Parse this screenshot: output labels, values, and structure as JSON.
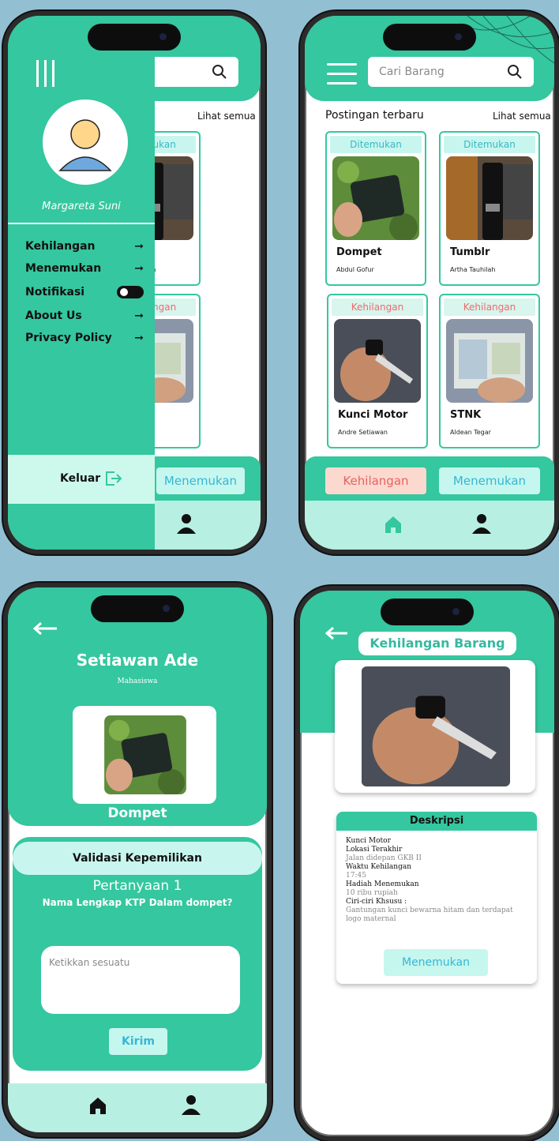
{
  "colors": {
    "background": "#93bfd3",
    "primary_green": "#35c79f",
    "mint": "#b7f0e2",
    "found_text": "#35b9c5",
    "lost_text": "#ef6b6b",
    "lost_button_bg": "#fbd9cf",
    "found_button_bg": "#c6f7ee"
  },
  "search": {
    "placeholder": "Cari Barang",
    "icon": "search-icon"
  },
  "feed": {
    "section_title": "Postingan terbaru",
    "see_all": "Lihat semua",
    "cards": [
      {
        "tag": "Ditemukan",
        "item": "Dompet",
        "person": "Abdul Gofur",
        "photo": "wallet"
      },
      {
        "tag": "Ditemukan",
        "item": "Tumblr",
        "person": "Artha Tauhilah",
        "photo": "tumbler"
      },
      {
        "tag": "Kehilangan",
        "item": "Kunci Motor",
        "person": "Andre Setiawan",
        "photo": "keys"
      },
      {
        "tag": "Kehilangan",
        "item": "STNK",
        "person": "Aldean Tegar",
        "photo": "stnk"
      }
    ],
    "btn_lost": "Kehilangan",
    "btn_found": "Menemukan"
  },
  "drawer": {
    "username": "Margareta Suni",
    "menu": [
      {
        "label": "Kehilangan",
        "trailing": "arrow"
      },
      {
        "label": "Menemukan",
        "trailing": "arrow"
      },
      {
        "label": "Notifikasi",
        "trailing": "toggle"
      },
      {
        "label": "About Us",
        "trailing": "arrow"
      },
      {
        "label": "Privacy Policy",
        "trailing": "arrow"
      }
    ],
    "logout": "Keluar"
  },
  "validation": {
    "owner_name": "Setiawan Ade",
    "owner_role": "Mahasiswa",
    "item": "Dompet",
    "section": "Validasi Kepemilikan",
    "question_number": "Pertanyaan 1",
    "question": "Nama Lengkap KTP Dalam dompet?",
    "answer_placeholder": "Ketikkan sesuatu",
    "submit": "Kirim"
  },
  "detail": {
    "title": "Kehilangan Barang",
    "desc_header": "Deskripsi",
    "item_name": "Kunci Motor",
    "location_label": "Lokasi Terakhir",
    "location_value": "Jalan didepan GKB II",
    "time_label": "Waktu Kehilangan",
    "time_value": "17:45",
    "reward_label": "Hadiah Menemukan",
    "reward_value": "10 ribu rupiah",
    "features_label": "Ciri-ciri Khsusu :",
    "features_value": "Gantungan kunci bewarna hitam dan terdapat logo maternal",
    "button": "Menemukan"
  }
}
